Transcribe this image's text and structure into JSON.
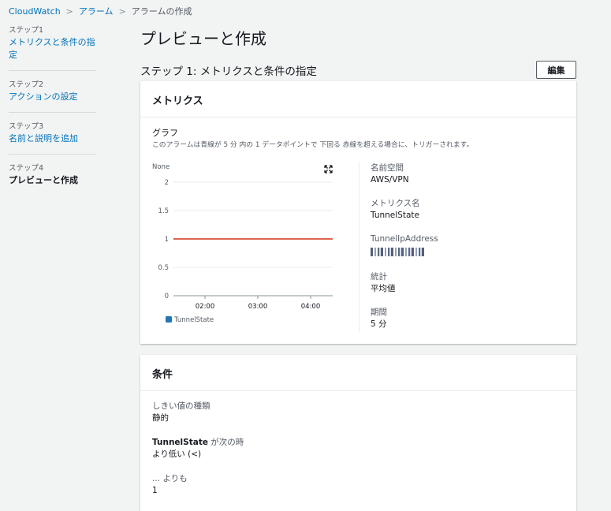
{
  "breadcrumb": {
    "items": [
      "CloudWatch",
      "アラーム",
      "アラームの作成"
    ]
  },
  "steps": [
    {
      "num": "ステップ1",
      "label": "メトリクスと条件の指定"
    },
    {
      "num": "ステップ2",
      "label": "アクションの設定"
    },
    {
      "num": "ステップ3",
      "label": "名前と説明を追加"
    },
    {
      "num": "ステップ4",
      "label": "プレビューと作成"
    }
  ],
  "page": {
    "title": "プレビューと作成",
    "section_title": "ステップ 1: メトリクスと条件の指定",
    "edit_label": "編集"
  },
  "metrics": {
    "header": "メトリクス",
    "graph_label": "グラフ",
    "graph_desc": "このアラームは青線が 5 分 内の 1 データポイントで 下回る 赤線を超える場合に、トリガーされます。",
    "info": {
      "namespace_label": "名前空間",
      "namespace": "AWS/VPN",
      "metric_name_label": "メトリクス名",
      "metric_name": "TunnelState",
      "tunnel_ip_label": "TunnelIpAddress",
      "statistic_label": "統計",
      "statistic": "平均値",
      "period_label": "期間",
      "period": "5 分"
    }
  },
  "chart_data": {
    "type": "line",
    "ylabel": "None",
    "ylim": [
      0,
      2
    ],
    "yticks": [
      "2",
      "1.5",
      "1",
      "0.5",
      "0"
    ],
    "xticks": [
      "02:00",
      "03:00",
      "04:00"
    ],
    "threshold": 1,
    "threshold_color": "#d13212",
    "series": [
      {
        "name": "TunnelState",
        "color": "#1f77b4",
        "values": []
      }
    ],
    "legend": "bottom-left",
    "grid": true
  },
  "conditions": {
    "header": "条件",
    "threshold_type_label": "しきい値の種類",
    "threshold_type": "静的",
    "when_metric": "TunnelState",
    "when_suffix": " が次の時",
    "when_value": "より低い (<)",
    "than_label": "... よりも",
    "than_value": "1"
  }
}
